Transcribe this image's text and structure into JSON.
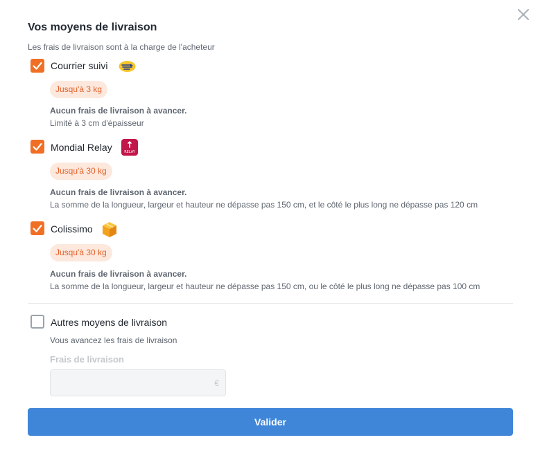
{
  "dialog": {
    "title": "Vos moyens de livraison",
    "subtitle": "Les frais de livraison sont à la charge de l'acheteur"
  },
  "options": [
    {
      "label": "Courrier suivi",
      "checked": true,
      "icon": "la-poste-logo-icon",
      "weight": "Jusqu'à 3 kg",
      "desc_bold": "Aucun frais de livraison à avancer.",
      "desc": "Limité à 3 cm d'épaisseur"
    },
    {
      "label": "Mondial Relay",
      "checked": true,
      "icon": "mondial-relay-logo-icon",
      "logo_text": "RELAY",
      "weight": "Jusqu'à 30 kg",
      "desc_bold": "Aucun frais de livraison à avancer.",
      "desc": "La somme de la longueur, largeur et hauteur ne dépasse pas 150 cm, et le côté le plus long ne dépasse pas 120 cm"
    },
    {
      "label": "Colissimo",
      "checked": true,
      "icon": "colissimo-box-icon",
      "weight": "Jusqu'à 30 kg",
      "desc_bold": "Aucun frais de livraison à avancer.",
      "desc": "La somme de la longueur, largeur et hauteur ne dépasse pas 150 cm, ou le côté le plus long ne dépasse pas 100 cm"
    }
  ],
  "other": {
    "label": "Autres moyens de livraison",
    "checked": false,
    "desc": "Vous avancez les frais de livraison",
    "field_label": "Frais de livraison",
    "field_value": "",
    "currency": "€"
  },
  "submit_label": "Valider",
  "colors": {
    "accent": "#f06f24",
    "button": "#3f86d9",
    "pill_bg": "#fde8dd",
    "pill_text": "#e4622a"
  }
}
